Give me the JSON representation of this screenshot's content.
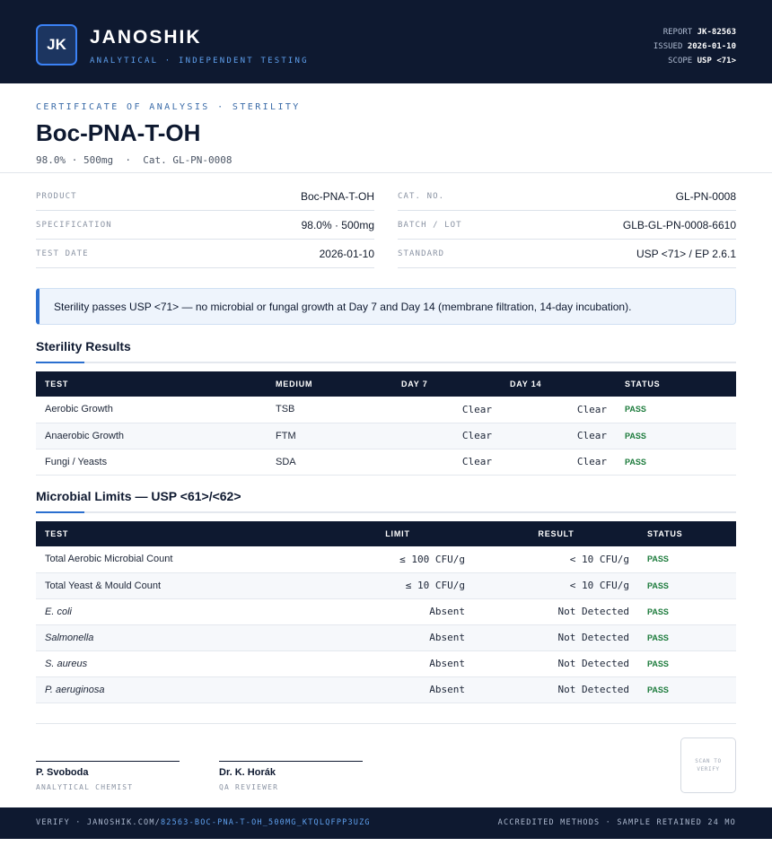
{
  "header": {
    "logo_initials": "JK",
    "brand_name": "JANOSHIK",
    "tagline": "ANALYTICAL · INDEPENDENT TESTING",
    "report_label": "REPORT",
    "report_value": "JK-82563",
    "issued_label": "ISSUED",
    "issued_value": "2026-01-10",
    "scope_label": "SCOPE",
    "scope_value": "USP <71>"
  },
  "title_block": {
    "eyebrow": "CERTIFICATE OF ANALYSIS · STERILITY",
    "title": "Boc-PNA-T-OH",
    "subtitle": "98.0% · 500mg  ·  Cat. GL-PN-0008"
  },
  "info": {
    "left": [
      {
        "label": "PRODUCT",
        "value": "Boc-PNA-T-OH"
      },
      {
        "label": "SPECIFICATION",
        "value": "98.0% · 500mg"
      },
      {
        "label": "TEST DATE",
        "value": "2026-01-10"
      }
    ],
    "right": [
      {
        "label": "CAT. NO.",
        "value": "GL-PN-0008"
      },
      {
        "label": "BATCH / LOT",
        "value": "GLB-GL-PN-0008-6610"
      },
      {
        "label": "STANDARD",
        "value": "USP <71> / EP 2.6.1"
      }
    ]
  },
  "callout": "Sterility passes USP <71> — no microbial or fungal growth at Day 7 and Day 14 (membrane filtration, 14-day incubation).",
  "sterility": {
    "title": "Sterility Results",
    "headers": [
      "TEST",
      "MEDIUM",
      "DAY 7",
      "DAY 14",
      "STATUS"
    ],
    "rows": [
      {
        "test": "Aerobic Growth",
        "medium": "TSB",
        "day7": "Clear",
        "day14": "Clear",
        "status": "PASS"
      },
      {
        "test": "Anaerobic Growth",
        "medium": "FTM",
        "day7": "Clear",
        "day14": "Clear",
        "status": "PASS"
      },
      {
        "test": "Fungi / Yeasts",
        "medium": "SDA",
        "day7": "Clear",
        "day14": "Clear",
        "status": "PASS"
      }
    ]
  },
  "microbial": {
    "title": "Microbial Limits — USP <61>/<62>",
    "headers": [
      "TEST",
      "LIMIT",
      "RESULT",
      "STATUS"
    ],
    "rows": [
      {
        "test": "Total Aerobic Microbial Count",
        "limit": "≤ 100 CFU/g",
        "result": "< 10 CFU/g",
        "status": "PASS"
      },
      {
        "test": "Total Yeast & Mould Count",
        "limit": "≤ 10 CFU/g",
        "result": "< 10 CFU/g",
        "status": "PASS"
      },
      {
        "test": "E. coli",
        "limit": "Absent",
        "result": "Not Detected",
        "status": "PASS"
      },
      {
        "test": "Salmonella",
        "limit": "Absent",
        "result": "Not Detected",
        "status": "PASS"
      },
      {
        "test": "S. aureus",
        "limit": "Absent",
        "result": "Not Detected",
        "status": "PASS"
      },
      {
        "test": "P. aeruginosa",
        "limit": "Absent",
        "result": "Not Detected",
        "status": "PASS"
      }
    ]
  },
  "signatures": [
    {
      "name": "P. Svoboda",
      "role": "ANALYTICAL CHEMIST"
    },
    {
      "name": "Dr. K. Horák",
      "role": "QA REVIEWER"
    }
  ],
  "qr_text": "SCAN TO VERIFY",
  "footer": {
    "verify_prefix": "VERIFY · JANOSHIK.COM/",
    "verify_link": "82563-BOC-PNA-T-OH_500MG_KTQLQFPP3UZG",
    "right": "ACCREDITED METHODS · SAMPLE RETAINED 24 MO"
  }
}
